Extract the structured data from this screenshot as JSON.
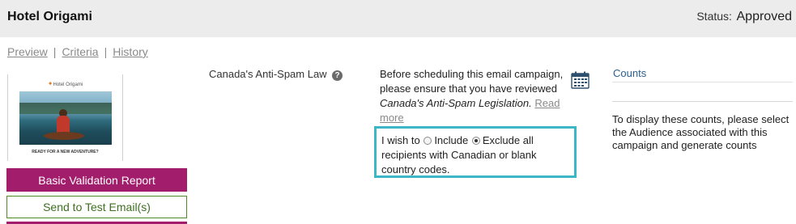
{
  "header": {
    "title": "Hotel Origami",
    "status_label": "Status:",
    "status_value": "Approved"
  },
  "nav": {
    "preview": "Preview",
    "separator": "|",
    "criteria": "Criteria",
    "history": "History"
  },
  "thumbnail": {
    "logo_text": "Hotel Origami",
    "tagline": "READY FOR A NEW ADVENTURE?"
  },
  "buttons": {
    "validation": "Basic Validation Report",
    "test_email": "Send to Test Email(s)"
  },
  "casl": {
    "label": "Canada's Anti-Spam Law",
    "help_icon": "?",
    "notice_prefix": "Before scheduling this email campaign, please ensure that you have reviewed",
    "notice_link_text": "Canada's Anti-Spam Legislation.",
    "read_more": "Read more",
    "wish_prefix": "I wish to",
    "option_include": "Include",
    "option_exclude": "Exclude all recipients with Canadian or blank country codes.",
    "selected_option": "exclude"
  },
  "counts": {
    "title": "Counts",
    "message": "To display these counts, please select the Audience associated with this campaign and generate counts"
  },
  "icons": {
    "help": "question-mark-circle-icon",
    "calendar": "calendar-icon"
  },
  "colors": {
    "accent_magenta": "#a31d6d",
    "test_green": "#4e8a2a",
    "highlight_teal": "#3fb5c8",
    "link_blue": "#2a5f8f"
  }
}
